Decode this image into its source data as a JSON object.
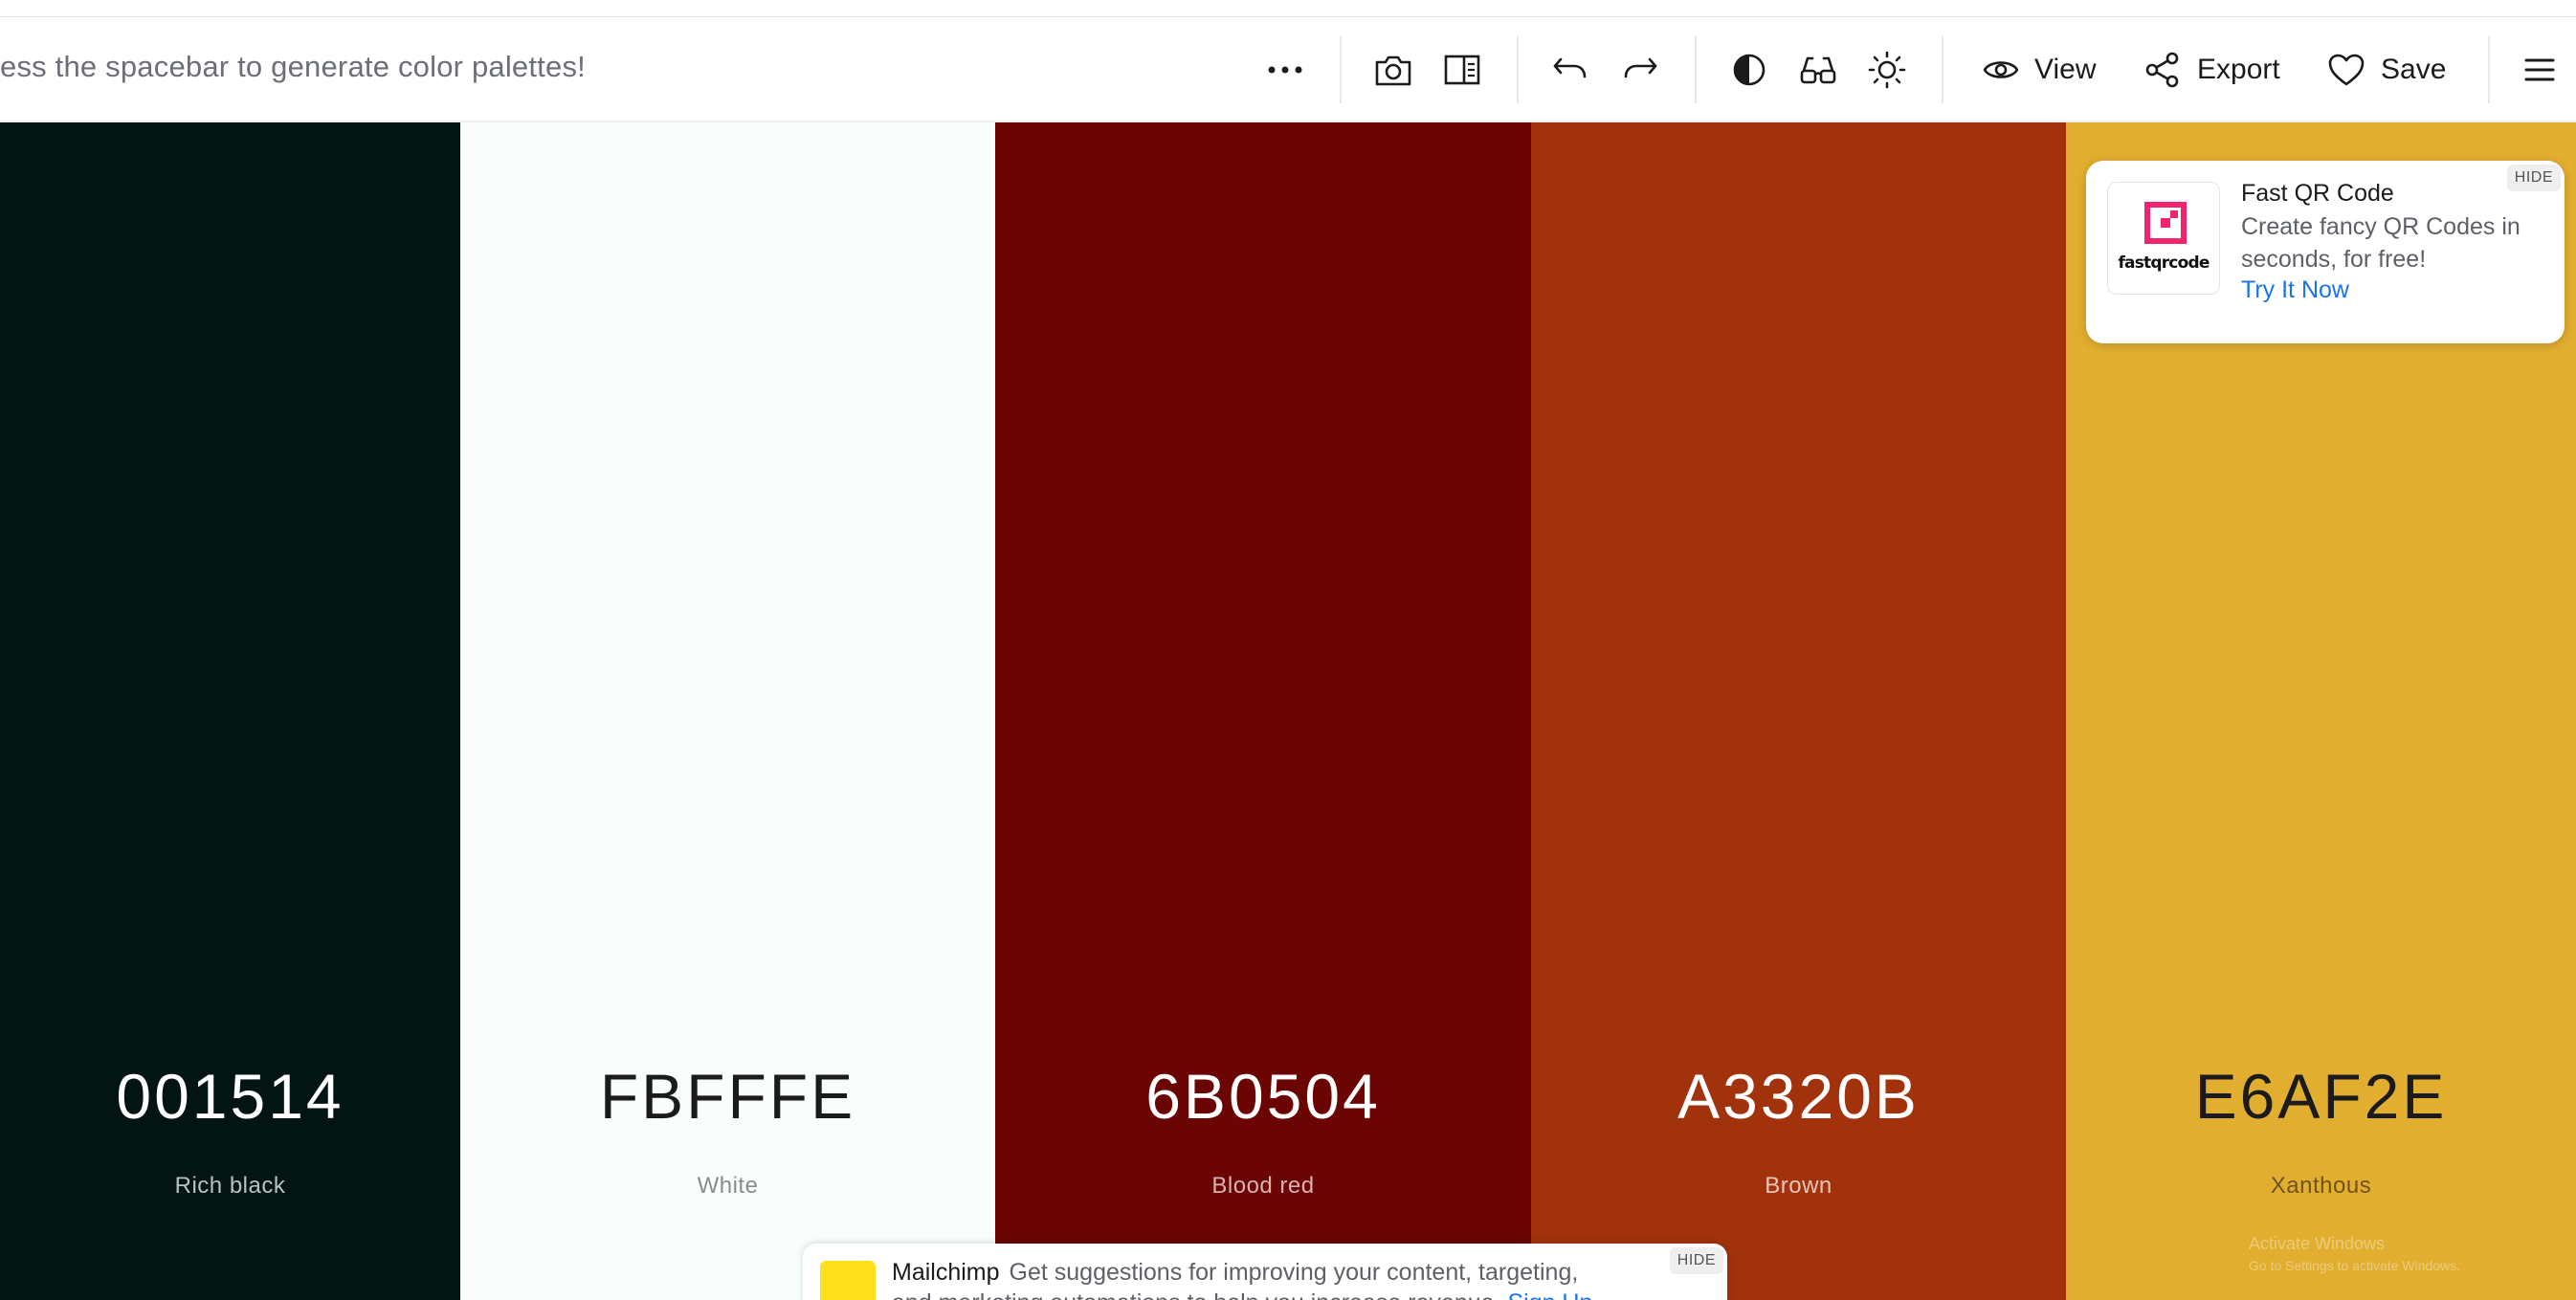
{
  "toolbar": {
    "hint": "ess the spacebar to generate color palettes!",
    "view_label": "View",
    "export_label": "Export",
    "save_label": "Save"
  },
  "icons": {
    "more": "more-horizontal-icon",
    "camera": "camera-icon",
    "panel": "side-panel-icon",
    "undo": "undo-icon",
    "redo": "redo-icon",
    "contrast": "contrast-icon",
    "glasses": "glasses-icon",
    "brightness": "sun-icon",
    "view": "eye-icon",
    "export": "share-icon",
    "save": "heart-icon",
    "menu": "hamburger-menu-icon"
  },
  "palette": [
    {
      "hex": "001514",
      "name": "Rich black",
      "bg": "#031513",
      "fg": "#ffffff",
      "name_color": "#b8c2c1"
    },
    {
      "hex": "FBFFFE",
      "name": "White",
      "bg": "#f9fefd",
      "fg": "#1b1b1d",
      "name_color": "#8a8c90"
    },
    {
      "hex": "6B0504",
      "name": "Blood red",
      "bg": "#6a0504",
      "fg": "#ffffff",
      "name_color": "#d9b3b2"
    },
    {
      "hex": "A3320B",
      "name": "Brown",
      "bg": "#a2320c",
      "fg": "#ffffff",
      "name_color": "#ecc6b9"
    },
    {
      "hex": "E6AF2E",
      "name": "Xanthous",
      "bg": "#e2ae30",
      "fg": "#1b1b1d",
      "name_color": "#6e5418"
    }
  ],
  "ad": {
    "title": "Fast QR Code",
    "text": "Create fancy QR Codes in seconds, for free!",
    "link": "Try It Now",
    "logo_text": "fastqrcode",
    "hide": "HIDE",
    "accent": "#f0246f"
  },
  "mailchimp": {
    "brand": "Mailchimp",
    "text": "Get suggestions for improving your content, targeting,",
    "line2": "and marketing automations to help you increase revenue.",
    "link": "Sign Up",
    "hide": "HIDE",
    "logo_color": "#ffe01b"
  },
  "watermark": {
    "line1": "Activate Windows",
    "line2": "Go to Settings to activate Windows."
  }
}
